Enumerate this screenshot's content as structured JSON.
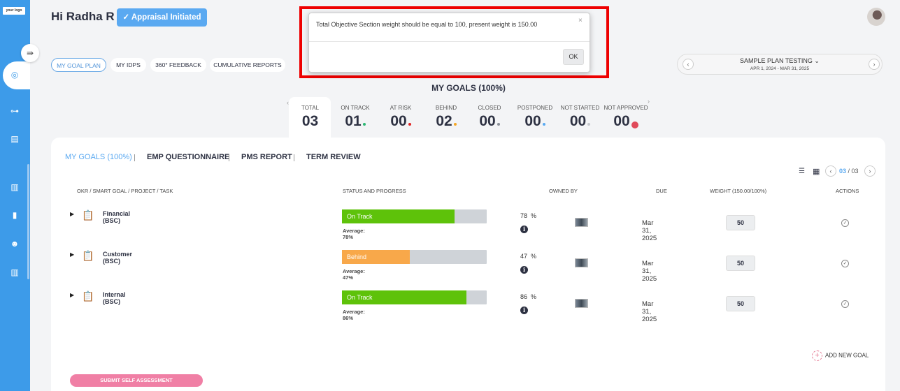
{
  "sidebar": {
    "logo_text": "your logo",
    "icons": [
      "target-icon",
      "hierarchy-icon",
      "document-edit-icon",
      "bar-chart-icon",
      "book-icon",
      "people-icon",
      "report-chart-icon"
    ]
  },
  "header": {
    "greeting": "Hi Radha R",
    "appraisal_button": "✓ Appraisal Initiated"
  },
  "tabs": [
    {
      "label": "MY GOAL PLAN"
    },
    {
      "label": "MY IDPS"
    },
    {
      "label": "360° FEEDBACK"
    },
    {
      "label": "CUMULATIVE REPORTS"
    }
  ],
  "period": {
    "plan_name": "SAMPLE PLAN TESTING",
    "date_range": "APR 1, 2024 - MAR 31, 2025"
  },
  "goals_title": "MY GOALS (100%)",
  "stats": [
    {
      "label": "TOTAL",
      "value": "03",
      "color": ""
    },
    {
      "label": "ON TRACK",
      "value": "01",
      "color": "#2bb673"
    },
    {
      "label": "AT RISK",
      "value": "00",
      "color": "#e02424"
    },
    {
      "label": "BEHIND",
      "value": "02",
      "color": "#f5a623"
    },
    {
      "label": "CLOSED",
      "value": "00",
      "color": "#8a8f98"
    },
    {
      "label": "POSTPONED",
      "value": "00",
      "color": "#5aa9f1"
    },
    {
      "label": "NOT STARTED",
      "value": "00",
      "color": "#c4c7cc"
    },
    {
      "label": "NOT APPROVED",
      "value": "00",
      "color": "#e04a5a"
    }
  ],
  "section_tabs": [
    "MY GOALS (100%)",
    "EMP QUESTIONNAIRE",
    "PMS REPORT",
    "TERM REVIEW"
  ],
  "pagination": {
    "current": "03",
    "separator": "/ 03"
  },
  "columns": {
    "goal": "OKR / SMART GOAL / PROJECT / TASK",
    "status": "STATUS AND PROGRESS",
    "owned_by": "OWNED BY",
    "due": "DUE",
    "weight": "WEIGHT (150.00/100%)",
    "actions": "ACTIONS"
  },
  "goals": [
    {
      "name": "Financial (BSC)",
      "status": "On Track",
      "progress": 0.78,
      "color": "#5ec20a",
      "average": "Average: 78%",
      "percent": "78  %",
      "due": "Mar 31, 2025",
      "weight": "50"
    },
    {
      "name": "Customer (BSC)",
      "status": "Behind",
      "progress": 0.47,
      "color": "#f8a84a",
      "average": "Average: 47%",
      "percent": "47  %",
      "due": "Mar 31, 2025",
      "weight": "50"
    },
    {
      "name": "Internal (BSC)",
      "status": "On Track",
      "progress": 0.86,
      "color": "#5ec20a",
      "average": "Average: 86%",
      "percent": "86  %",
      "due": "Mar 31, 2025",
      "weight": "50"
    }
  ],
  "add_goal_label": "ADD NEW GOAL",
  "submit_label": "SUBMIT SELF ASSESSMENT",
  "modal": {
    "message": "Total Objective Section weight should be equal to 100, present weight is 150.00",
    "close": "×",
    "ok": "OK"
  }
}
